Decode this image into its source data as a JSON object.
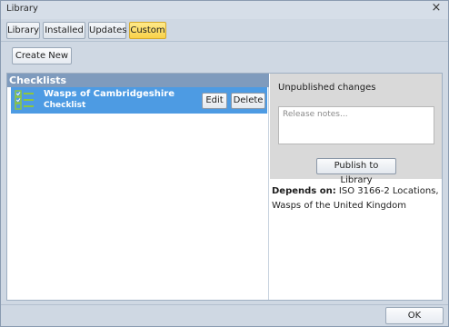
{
  "window": {
    "title": "Library",
    "close_glyph": "×",
    "close_icon": "close-icon"
  },
  "tabs": [
    {
      "label": "Library",
      "active": false
    },
    {
      "label": "Installed",
      "active": false
    },
    {
      "label": "Updates",
      "active": false
    },
    {
      "label": "Custom",
      "active": true
    }
  ],
  "toolbar": {
    "create_label": "Create New"
  },
  "checklists": {
    "header": "Checklists",
    "items": [
      {
        "title": "Wasps of Cambridgeshire",
        "subtitle": "Checklist",
        "icon": "checklist-icon",
        "edit_label": "Edit",
        "delete_label": "Delete",
        "selected": true
      }
    ]
  },
  "publish": {
    "heading": "Unpublished changes",
    "notes_placeholder": "Release notes...",
    "notes_value": "",
    "button_label": "Publish to Library"
  },
  "depends": {
    "label": "Depends on:",
    "value": "ISO 3166-2 Locations, Wasps of the United Kingdom"
  },
  "footer": {
    "ok_label": "OK"
  },
  "colors": {
    "selection": "#4d9be3",
    "header": "#7f9bbd",
    "active_tab": "#f9d24a",
    "icon_green": "#8dc63f"
  }
}
